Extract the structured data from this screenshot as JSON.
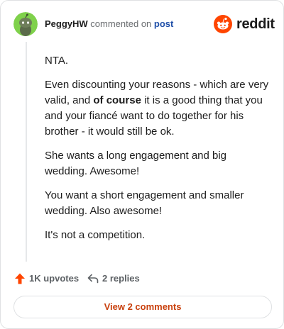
{
  "header": {
    "username": "PeggyHW",
    "commented_text": "commented on",
    "post_link": "post",
    "brand": "reddit"
  },
  "comment": {
    "paragraph_1": "NTA.",
    "paragraph_2_before": "Even discounting your reasons - which are very valid, and ",
    "paragraph_2_bold": "of course",
    "paragraph_2_after": " it is a good thing that you and your fiancé want to do together for his brother - it would still be ok.",
    "paragraph_3": "She wants a long engagement and big wedding. Awesome!",
    "paragraph_4": "You want a short engagement and smaller wedding. Also awesome!",
    "paragraph_5": "It's not a competition."
  },
  "actions": {
    "upvotes": "1K upvotes",
    "replies": "2 replies"
  },
  "footer": {
    "view_comments": "View 2 comments"
  },
  "colors": {
    "accent_orange": "#ff4500",
    "link_blue": "#1f4fa8",
    "avatar_green": "#7fd14b",
    "button_text": "#c9400d"
  },
  "icons": {
    "avatar": "snoo-avatar-icon",
    "brand": "reddit-logo-icon",
    "upvote": "upvote-arrow-icon",
    "reply": "reply-arrow-icon"
  }
}
